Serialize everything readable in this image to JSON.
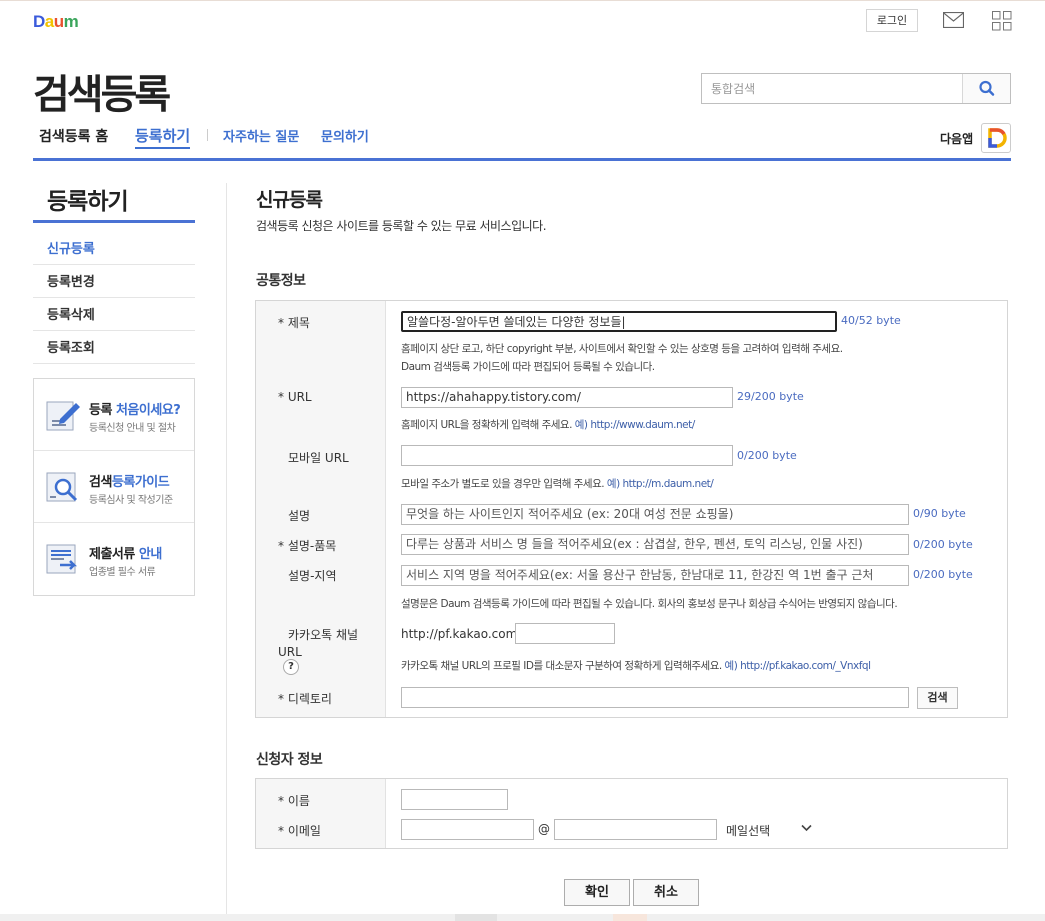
{
  "header": {
    "logo": {
      "d": "D",
      "a": "a",
      "u": "u",
      "m": "m"
    },
    "login_label": "로그인",
    "page_title": "검색등록",
    "search_placeholder": "통합검색",
    "gnb": {
      "home": "검색등록 홈",
      "register": "등록하기",
      "faq": "자주하는 질문",
      "inquiry": "문의하기"
    },
    "app_label": "다음앱"
  },
  "lnb": {
    "title": "등록하기",
    "items": [
      "신규등록",
      "등록변경",
      "등록삭제",
      "등록조회"
    ],
    "box": [
      {
        "title_a": "등록 ",
        "title_b": "처음이세요?",
        "sub": "등록신청 안내 및 절차",
        "icon": "pencil-doc-icon"
      },
      {
        "title_a": "검색",
        "title_b": "등록가이드",
        "sub": "등록심사 및 작성기준",
        "icon": "magnifier-doc-icon"
      },
      {
        "title_a": "제출서류 ",
        "title_b": "안내",
        "sub": "업종별 필수 서류",
        "icon": "document-arrow-icon"
      }
    ]
  },
  "content": {
    "title": "신규등록",
    "desc": "검색등록 신청은 사이트를 등록할 수 있는 무료 서비스입니다.",
    "common_section": "공통정보",
    "fields": {
      "title_label": "* 제목",
      "title_value": "알쓸다정-알아두면 쓸데있는 다양한 정보들|",
      "title_byte": "40/52 byte",
      "title_help1": "홈페이지 상단 로고, 하단 copyright 부분, 사이트에서 확인할 수 있는 상호명 등을 고려하여 입력해 주세요.",
      "title_help2": "Daum 검색등록 가이드에 따라 편집되어 등록될 수 있습니다.",
      "url_label": "* URL",
      "url_value": "https://ahahappy.tistory.com/",
      "url_byte": "29/200 byte",
      "url_help": "홈페이지 URL을 정확하게 입력해 주세요. ",
      "url_help_link": "예) http://www.daum.net/",
      "murl_label": "모바일 URL",
      "murl_value": "",
      "murl_byte": "0/200 byte",
      "murl_help": "모바일 주소가 별도로 있을 경우만 입력해 주세요. ",
      "murl_help_link": "예) http://m.daum.net/",
      "desc_label": "설명",
      "desc_placeholder": "무엇을 하는 사이트인지 적어주세요 (ex: 20대 여성 전문 쇼핑몰)",
      "desc_byte": "0/90 byte",
      "prod_label": "* 설명-품목",
      "prod_placeholder": "다루는 상품과 서비스 명 들을 적어주세요(ex : 삼겹살, 한우, 펜션, 토익 리스닝, 인물 사진)",
      "prod_byte": "0/200 byte",
      "area_label": "설명-지역",
      "area_placeholder": "서비스 지역 명을 적어주세요(ex: 서울  용산구 한남동, 한남대로 11, 한강진 역 1번 출구 근처",
      "area_byte": "0/200 byte",
      "desc_help": "설명문은 Daum 검색등록 가이드에 따라 편집될 수 있습니다. 회사의 홍보성 문구나 회상급 수식어는 반영되지 않습니다.",
      "kakao_label1": "카카오톡 채널",
      "kakao_label2": "URL",
      "kakao_q": "?",
      "kakao_prefix": "http://pf.kakao.com/",
      "kakao_value": "",
      "kakao_help": "카카오톡 채널 URL의 프로필 ID를 대소문자 구분하여 정확하게 입력해주세요. ",
      "kakao_help_link": "예) http://pf.kakao.com/_Vnxfql",
      "dir_label": "* 디렉토리",
      "dir_value": "",
      "dir_btn": "검색"
    },
    "applicant_section": "신청자 정보",
    "applicant": {
      "name_label": "* 이름",
      "name_value": "",
      "email_label": "* 이메일",
      "email_id": "",
      "at": "@",
      "email_domain": "",
      "email_select": "메일선택"
    },
    "buttons": {
      "confirm": "확인",
      "cancel": "취소"
    }
  }
}
